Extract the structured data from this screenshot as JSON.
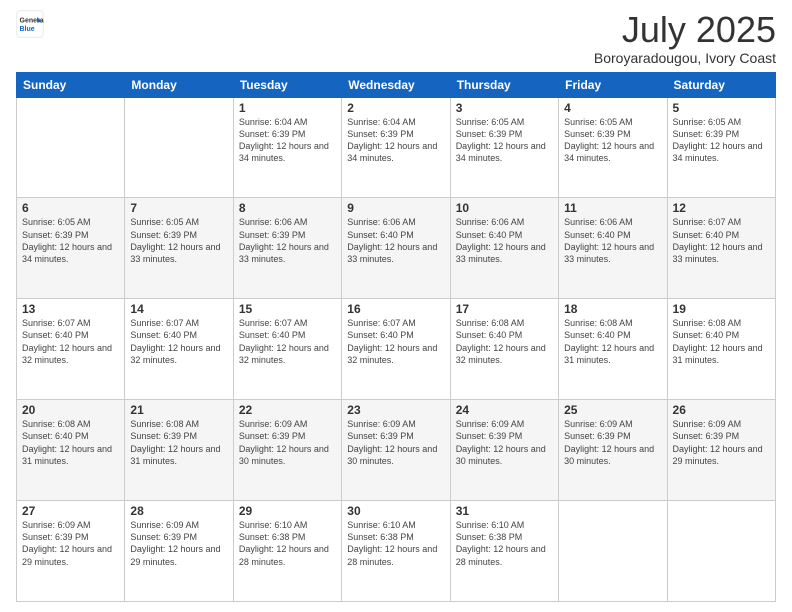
{
  "logo": {
    "general": "General",
    "blue": "Blue"
  },
  "header": {
    "title": "July 2025",
    "subtitle": "Boroyaradougou, Ivory Coast"
  },
  "days": [
    "Sunday",
    "Monday",
    "Tuesday",
    "Wednesday",
    "Thursday",
    "Friday",
    "Saturday"
  ],
  "weeks": [
    [
      {
        "day": "",
        "info": ""
      },
      {
        "day": "",
        "info": ""
      },
      {
        "day": "1",
        "info": "Sunrise: 6:04 AM\nSunset: 6:39 PM\nDaylight: 12 hours and 34 minutes."
      },
      {
        "day": "2",
        "info": "Sunrise: 6:04 AM\nSunset: 6:39 PM\nDaylight: 12 hours and 34 minutes."
      },
      {
        "day": "3",
        "info": "Sunrise: 6:05 AM\nSunset: 6:39 PM\nDaylight: 12 hours and 34 minutes."
      },
      {
        "day": "4",
        "info": "Sunrise: 6:05 AM\nSunset: 6:39 PM\nDaylight: 12 hours and 34 minutes."
      },
      {
        "day": "5",
        "info": "Sunrise: 6:05 AM\nSunset: 6:39 PM\nDaylight: 12 hours and 34 minutes."
      }
    ],
    [
      {
        "day": "6",
        "info": "Sunrise: 6:05 AM\nSunset: 6:39 PM\nDaylight: 12 hours and 34 minutes."
      },
      {
        "day": "7",
        "info": "Sunrise: 6:05 AM\nSunset: 6:39 PM\nDaylight: 12 hours and 33 minutes."
      },
      {
        "day": "8",
        "info": "Sunrise: 6:06 AM\nSunset: 6:39 PM\nDaylight: 12 hours and 33 minutes."
      },
      {
        "day": "9",
        "info": "Sunrise: 6:06 AM\nSunset: 6:40 PM\nDaylight: 12 hours and 33 minutes."
      },
      {
        "day": "10",
        "info": "Sunrise: 6:06 AM\nSunset: 6:40 PM\nDaylight: 12 hours and 33 minutes."
      },
      {
        "day": "11",
        "info": "Sunrise: 6:06 AM\nSunset: 6:40 PM\nDaylight: 12 hours and 33 minutes."
      },
      {
        "day": "12",
        "info": "Sunrise: 6:07 AM\nSunset: 6:40 PM\nDaylight: 12 hours and 33 minutes."
      }
    ],
    [
      {
        "day": "13",
        "info": "Sunrise: 6:07 AM\nSunset: 6:40 PM\nDaylight: 12 hours and 32 minutes."
      },
      {
        "day": "14",
        "info": "Sunrise: 6:07 AM\nSunset: 6:40 PM\nDaylight: 12 hours and 32 minutes."
      },
      {
        "day": "15",
        "info": "Sunrise: 6:07 AM\nSunset: 6:40 PM\nDaylight: 12 hours and 32 minutes."
      },
      {
        "day": "16",
        "info": "Sunrise: 6:07 AM\nSunset: 6:40 PM\nDaylight: 12 hours and 32 minutes."
      },
      {
        "day": "17",
        "info": "Sunrise: 6:08 AM\nSunset: 6:40 PM\nDaylight: 12 hours and 32 minutes."
      },
      {
        "day": "18",
        "info": "Sunrise: 6:08 AM\nSunset: 6:40 PM\nDaylight: 12 hours and 31 minutes."
      },
      {
        "day": "19",
        "info": "Sunrise: 6:08 AM\nSunset: 6:40 PM\nDaylight: 12 hours and 31 minutes."
      }
    ],
    [
      {
        "day": "20",
        "info": "Sunrise: 6:08 AM\nSunset: 6:40 PM\nDaylight: 12 hours and 31 minutes."
      },
      {
        "day": "21",
        "info": "Sunrise: 6:08 AM\nSunset: 6:39 PM\nDaylight: 12 hours and 31 minutes."
      },
      {
        "day": "22",
        "info": "Sunrise: 6:09 AM\nSunset: 6:39 PM\nDaylight: 12 hours and 30 minutes."
      },
      {
        "day": "23",
        "info": "Sunrise: 6:09 AM\nSunset: 6:39 PM\nDaylight: 12 hours and 30 minutes."
      },
      {
        "day": "24",
        "info": "Sunrise: 6:09 AM\nSunset: 6:39 PM\nDaylight: 12 hours and 30 minutes."
      },
      {
        "day": "25",
        "info": "Sunrise: 6:09 AM\nSunset: 6:39 PM\nDaylight: 12 hours and 30 minutes."
      },
      {
        "day": "26",
        "info": "Sunrise: 6:09 AM\nSunset: 6:39 PM\nDaylight: 12 hours and 29 minutes."
      }
    ],
    [
      {
        "day": "27",
        "info": "Sunrise: 6:09 AM\nSunset: 6:39 PM\nDaylight: 12 hours and 29 minutes."
      },
      {
        "day": "28",
        "info": "Sunrise: 6:09 AM\nSunset: 6:39 PM\nDaylight: 12 hours and 29 minutes."
      },
      {
        "day": "29",
        "info": "Sunrise: 6:10 AM\nSunset: 6:38 PM\nDaylight: 12 hours and 28 minutes."
      },
      {
        "day": "30",
        "info": "Sunrise: 6:10 AM\nSunset: 6:38 PM\nDaylight: 12 hours and 28 minutes."
      },
      {
        "day": "31",
        "info": "Sunrise: 6:10 AM\nSunset: 6:38 PM\nDaylight: 12 hours and 28 minutes."
      },
      {
        "day": "",
        "info": ""
      },
      {
        "day": "",
        "info": ""
      }
    ]
  ]
}
